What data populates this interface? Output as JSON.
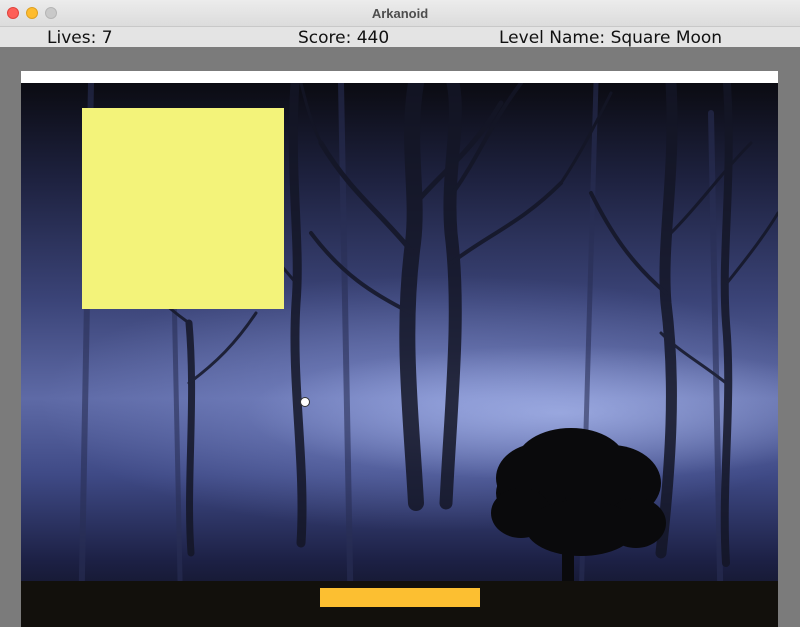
{
  "window": {
    "title": "Arkanoid"
  },
  "hud": {
    "lives": "Lives: 7",
    "score": "Score: 440",
    "level": "Level Name: Square  Moon"
  },
  "game": {
    "block_color": "#f3f37a",
    "paddle_color": "#fcbf31",
    "ball_color": "#ffffff",
    "wall_color": "#ffffff",
    "background_scene": "misty-forest-night"
  }
}
